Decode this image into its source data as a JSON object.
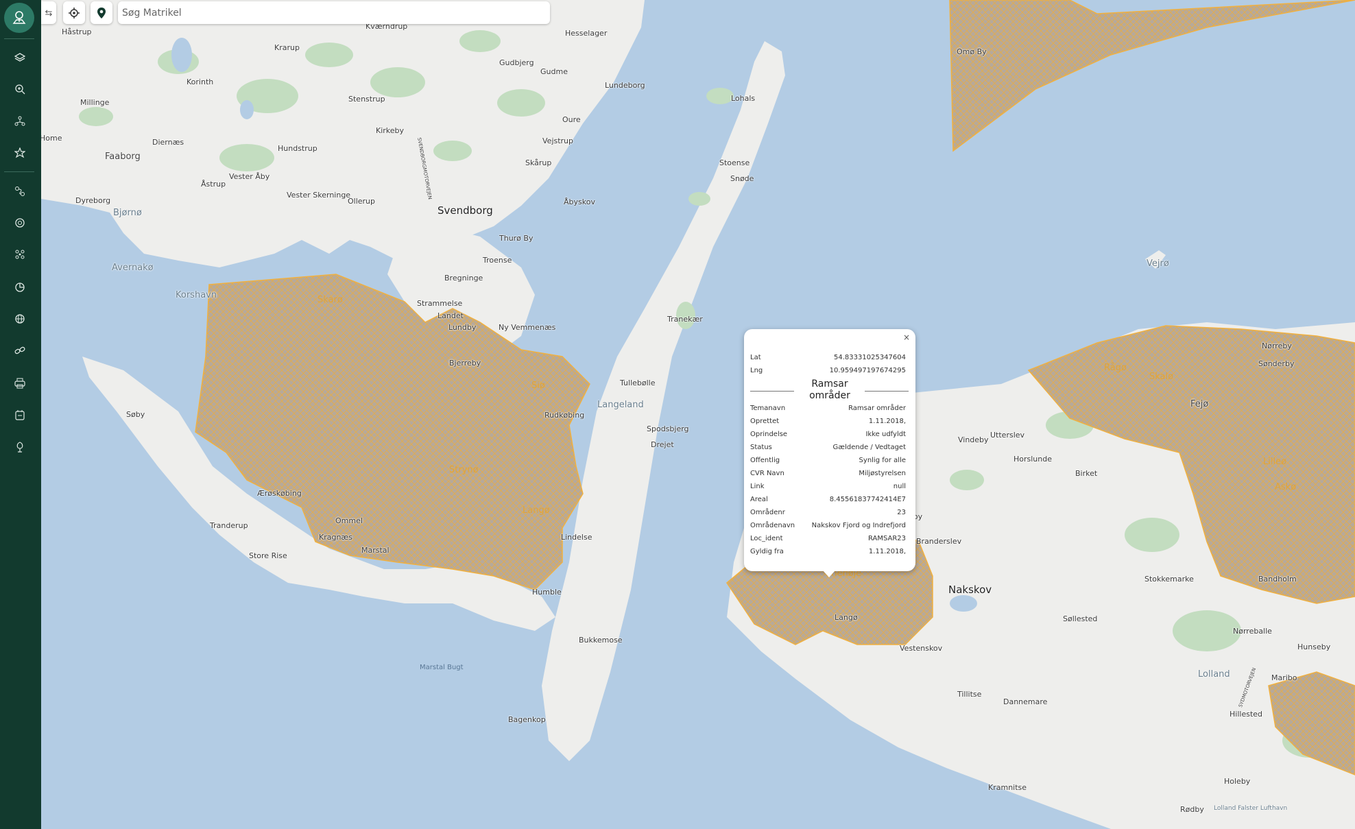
{
  "search": {
    "placeholder": "Søg Matrikel"
  },
  "sidebar": {
    "logo_icon": "user-location-icon",
    "items": [
      {
        "icon": "layers-icon"
      },
      {
        "icon": "zoom-search-icon"
      },
      {
        "icon": "network-icon"
      },
      {
        "icon": "star-marker-icon"
      },
      {
        "icon": "route-icon"
      },
      {
        "icon": "target-icon"
      },
      {
        "icon": "cluster-icon"
      },
      {
        "icon": "pie-chart-icon"
      },
      {
        "icon": "globe-icon"
      },
      {
        "icon": "link-icon"
      },
      {
        "icon": "printer-icon"
      },
      {
        "icon": "calendar-icon"
      },
      {
        "icon": "tree-icon"
      }
    ]
  },
  "toolbar": {
    "collapse_icon": "collapse-arrows-icon",
    "locate_icon": "crosshair-icon",
    "marker_icon": "map-pin-icon"
  },
  "colors": {
    "sidebar": "#123a2e",
    "water": "#b3cce4",
    "land": "#eeeeec",
    "forest": "#c3ddc0",
    "ramsar_outline": "#f0b040",
    "ramsar_fill": "#b7a99a"
  },
  "map": {
    "labels": [
      {
        "text": "Håstrup"
      },
      {
        "text": "Kværndrup"
      },
      {
        "text": "Hesselager"
      },
      {
        "text": "Krarup"
      },
      {
        "text": "Gudbjerg"
      },
      {
        "text": "Korinth"
      },
      {
        "text": "Gudme"
      },
      {
        "text": "Lundeborg"
      },
      {
        "text": "Millinge"
      },
      {
        "text": "Stenstrup"
      },
      {
        "text": "Oure"
      },
      {
        "text": "Lohals"
      },
      {
        "text": "Kirkeby"
      },
      {
        "text": "Vejstrup"
      },
      {
        "text": "Home"
      },
      {
        "text": "Diernæs"
      },
      {
        "text": "Hundstrup"
      },
      {
        "text": "Faaborg"
      },
      {
        "text": "Skårup"
      },
      {
        "text": "Stoense"
      },
      {
        "text": "Snøde"
      },
      {
        "text": "Vester Åby"
      },
      {
        "text": "Åstrup"
      },
      {
        "text": "Vester Skerninge"
      },
      {
        "text": "Ollerup"
      },
      {
        "text": "Dyreborg"
      },
      {
        "text": "Bjørnø"
      },
      {
        "text": "Svendborg"
      },
      {
        "text": "Åbyskov"
      },
      {
        "text": "Thurø By"
      },
      {
        "text": "Troense"
      },
      {
        "text": "Avernakø"
      },
      {
        "text": "Bregninge"
      },
      {
        "text": "Korshavn"
      },
      {
        "text": "Skarø"
      },
      {
        "text": "Strammelse"
      },
      {
        "text": "Landet"
      },
      {
        "text": "Lundby"
      },
      {
        "text": "Ny Vemmenæs"
      },
      {
        "text": "Tranekær"
      },
      {
        "text": "Bjerreby"
      },
      {
        "text": "Tullebølle"
      },
      {
        "text": "Siø"
      },
      {
        "text": "Langeland"
      },
      {
        "text": "Søby"
      },
      {
        "text": "Rudkøbing"
      },
      {
        "text": "Spodsbjerg"
      },
      {
        "text": "Drejet"
      },
      {
        "text": "Strynø"
      },
      {
        "text": "Ærøskøbing"
      },
      {
        "text": "Langø"
      },
      {
        "text": "Tranderup"
      },
      {
        "text": "Ommel"
      },
      {
        "text": "Lindelse"
      },
      {
        "text": "Kragnæs"
      },
      {
        "text": "Store Rise"
      },
      {
        "text": "Marstal"
      },
      {
        "text": "Humble"
      },
      {
        "text": "Bukkemose"
      },
      {
        "text": "Marstal Bugt"
      },
      {
        "text": "Bagenkop"
      },
      {
        "text": "Omø By"
      },
      {
        "text": "Vejrø"
      },
      {
        "text": "Nørreby"
      },
      {
        "text": "Sønderby"
      },
      {
        "text": "Rågø"
      },
      {
        "text": "Skalø"
      },
      {
        "text": "Fejø"
      },
      {
        "text": "Vindeby"
      },
      {
        "text": "Utterslev"
      },
      {
        "text": "Horslunde"
      },
      {
        "text": "Birket"
      },
      {
        "text": "Lilleø"
      },
      {
        "text": "Askø"
      },
      {
        "text": "Sandby"
      },
      {
        "text": "Branderslev"
      },
      {
        "text": "Nakskov"
      },
      {
        "text": "Stokkemarke"
      },
      {
        "text": "Bandholm"
      },
      {
        "text": "Enehøje"
      },
      {
        "text": "Langø"
      },
      {
        "text": "Søllested"
      },
      {
        "text": "Nørreballe"
      },
      {
        "text": "Vestenskov"
      },
      {
        "text": "Hunseby"
      },
      {
        "text": "Lolland"
      },
      {
        "text": "Maribo"
      },
      {
        "text": "Tillitse"
      },
      {
        "text": "Dannemare"
      },
      {
        "text": "Hillested"
      },
      {
        "text": "Kramnitse"
      },
      {
        "text": "Holeby"
      },
      {
        "text": "Rødby"
      },
      {
        "text": "Lolland Falster Lufthavn"
      },
      {
        "text": "SVENDBORGMOTORVEJEN"
      },
      {
        "text": "SYDMOTORVEJEN"
      }
    ]
  },
  "popup": {
    "close": "×",
    "lat_label": "Lat",
    "lat_value": "54.83331025347604",
    "lng_label": "Lng",
    "lng_value": "10.959497197674295",
    "title": "Ramsar områder",
    "rows": [
      {
        "label": "Temanavn",
        "value": "Ramsar områder"
      },
      {
        "label": "Oprettet",
        "value": "1.11.2018,"
      },
      {
        "label": "Oprindelse",
        "value": "Ikke udfyldt"
      },
      {
        "label": "Status",
        "value": "Gældende / Vedtaget"
      },
      {
        "label": "Offentlig",
        "value": "Synlig for alle"
      },
      {
        "label": "CVR Navn",
        "value": "Miljøstyrelsen"
      },
      {
        "label": "Link",
        "value": "null"
      },
      {
        "label": "Areal",
        "value": "8.45561837742414E7"
      },
      {
        "label": "Områdenr",
        "value": "23"
      },
      {
        "label": "Områdenavn",
        "value": "Nakskov Fjord og Indrefjord"
      },
      {
        "label": "Loc_ident",
        "value": "RAMSAR23"
      },
      {
        "label": "Gyldig fra",
        "value": "1.11.2018,"
      }
    ]
  }
}
